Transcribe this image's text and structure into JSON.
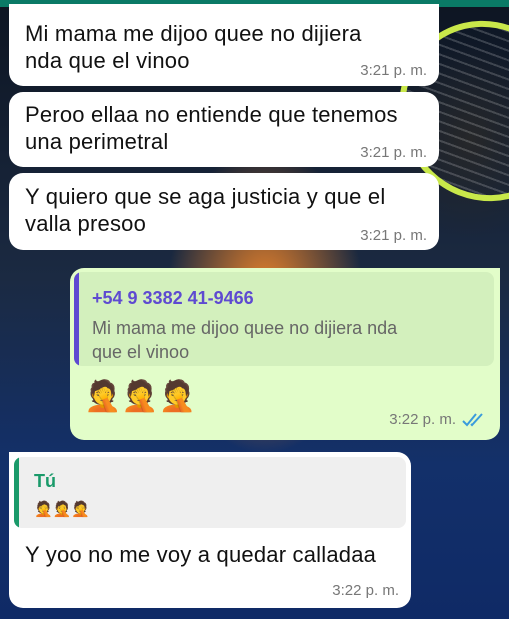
{
  "messages": [
    {
      "text_line1": "Mi mama me dijoo quee no dijiera",
      "text_line2": "nda que el vinoo",
      "time": "3:21 p. m."
    },
    {
      "text_line1": "Peroo ellaa no entiende que tenemos",
      "text_line2": "una perimetral",
      "time": "3:21 p. m."
    },
    {
      "text_line1": "Y quiero que se aga justicia y que el",
      "text_line2": "valla presoo",
      "time": "3:21 p. m."
    }
  ],
  "outgoing": {
    "quote_author": "+54 9 3382 41-9466",
    "quote_line1": "Mi mama me dijoo quee no dijiera nda",
    "quote_line2": "que el vinoo",
    "emoji": "🤦🤦🤦",
    "time": "3:22 p. m.",
    "status": "read"
  },
  "reply": {
    "quote_author": "Tú",
    "quote_emoji": "🤦🤦🤦",
    "text": "Y yoo no me voy a quedar calladaa",
    "time": "3:22 p. m."
  },
  "colors": {
    "incoming_bubble": "#ffffff",
    "outgoing_bubble": "#e2fdc9",
    "quote_author_purple": "#5e4ad1",
    "quote_author_green": "#1a9a6a",
    "read_ticks": "#3a9bdc"
  }
}
